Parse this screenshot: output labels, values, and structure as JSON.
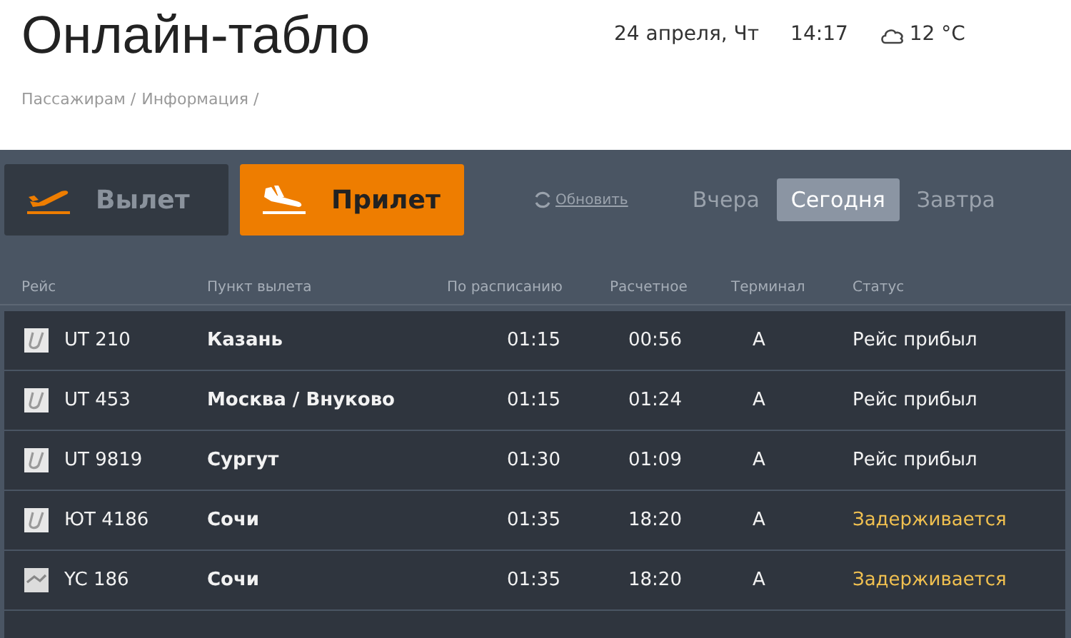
{
  "title": "Онлайн-табло",
  "date": "24 апреля, Чт",
  "time": "14:17",
  "weather": "12 °C",
  "breadcrumbs": [
    "Пассажирам /",
    "Информация /"
  ],
  "direction_tabs": [
    {
      "label": "Вылет",
      "kind": "departure",
      "selected": false
    },
    {
      "label": "Прилет",
      "kind": "arrival",
      "selected": true
    }
  ],
  "refresh": "Обновить",
  "day_tabs": [
    {
      "label": "Вчера",
      "selected": false
    },
    {
      "label": "Сегодня",
      "selected": true
    },
    {
      "label": "Завтра",
      "selected": false
    }
  ],
  "table": {
    "columns": [
      "Рейс",
      "Пункт вылета",
      "По расписанию",
      "Расчетное",
      "Терминал",
      "Статус"
    ],
    "rows": [
      {
        "logo": {
          "kind": "ut"
        },
        "flight": "UT 210",
        "origin": "Казань",
        "scheduled": "01:15",
        "estimated": "00:56",
        "terminal": "A",
        "status": {
          "text": "Рейс прибыл",
          "kind": "arrived"
        }
      },
      {
        "logo": {
          "kind": "ut"
        },
        "flight": "UT 453",
        "origin": "Москва / Внуково",
        "scheduled": "01:15",
        "estimated": "01:24",
        "terminal": "A",
        "status": {
          "text": "Рейс прибыл",
          "kind": "arrived"
        }
      },
      {
        "logo": {
          "kind": "ut"
        },
        "flight": "UT 9819",
        "origin": "Сургут",
        "scheduled": "01:30",
        "estimated": "01:09",
        "terminal": "A",
        "status": {
          "text": "Рейс прибыл",
          "kind": "arrived"
        }
      },
      {
        "logo": {
          "kind": "ut"
        },
        "flight": "ЮТ 4186",
        "origin": "Сочи",
        "scheduled": "01:35",
        "estimated": "18:20",
        "terminal": "A",
        "status": {
          "text": "Задерживается",
          "kind": "delayed"
        }
      },
      {
        "logo": {
          "kind": "yc"
        },
        "flight": "YC 186",
        "origin": "Сочи",
        "scheduled": "01:35",
        "estimated": "18:20",
        "terminal": "A",
        "status": {
          "text": "Задерживается",
          "kind": "delayed"
        }
      }
    ]
  }
}
